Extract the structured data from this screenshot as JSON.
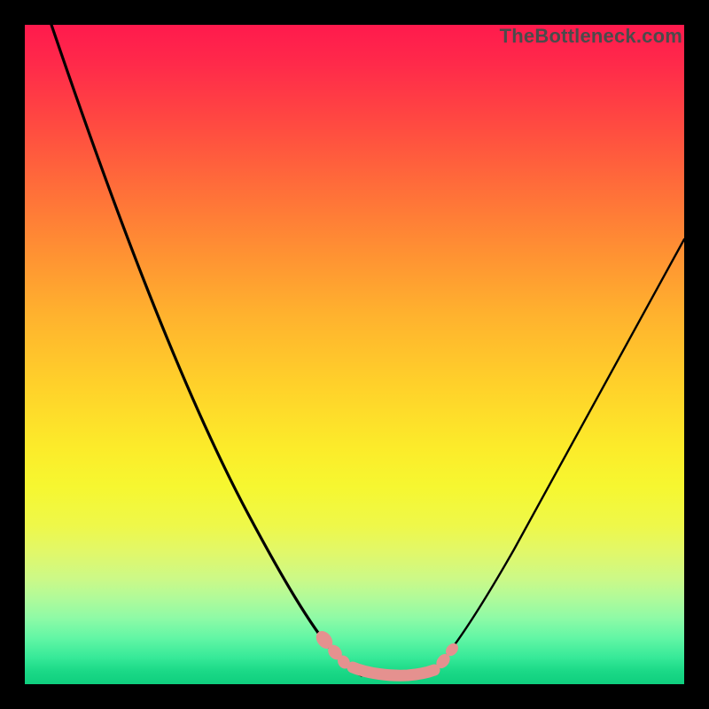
{
  "watermark": "TheBottleneck.com",
  "chart_data": {
    "type": "line",
    "title": "",
    "xlabel": "",
    "ylabel": "",
    "xlim": [
      0,
      100
    ],
    "ylim": [
      0,
      100
    ],
    "background_gradient": {
      "orientation": "vertical",
      "stops": [
        {
          "pos": 0,
          "color": "#ff1a4d"
        },
        {
          "pos": 45,
          "color": "#ffb02e"
        },
        {
          "pos": 65,
          "color": "#fceb2a"
        },
        {
          "pos": 88,
          "color": "#8efaa6"
        },
        {
          "pos": 100,
          "color": "#0fcf7e"
        }
      ]
    },
    "series": [
      {
        "name": "left-curve",
        "color": "#000000",
        "x": [
          4,
          10,
          16,
          22,
          28,
          34,
          38,
          42,
          45,
          48,
          50
        ],
        "y": [
          100,
          83,
          67,
          51,
          37,
          25,
          17,
          11,
          7,
          4,
          2
        ]
      },
      {
        "name": "right-curve",
        "color": "#000000",
        "x": [
          62,
          65,
          68,
          72,
          78,
          85,
          92,
          100
        ],
        "y": [
          3,
          6,
          11,
          19,
          32,
          47,
          60,
          72
        ]
      },
      {
        "name": "valley-floor",
        "color": "#e08080",
        "x": [
          44,
          47,
          48,
          50,
          52,
          55,
          58,
          60,
          62,
          63
        ],
        "y": [
          7,
          4,
          3,
          2,
          1.5,
          1.5,
          1.7,
          2,
          3,
          4
        ]
      }
    ],
    "marker_clusters": [
      {
        "name": "left-cluster",
        "x": 46,
        "y": 6,
        "count": 3,
        "color": "#e5918f"
      },
      {
        "name": "floor-cluster",
        "x": 55,
        "y": 1.5,
        "count": 6,
        "color": "#e5918f"
      },
      {
        "name": "right-cluster",
        "x": 62.5,
        "y": 4,
        "count": 2,
        "color": "#e5918f"
      }
    ]
  }
}
